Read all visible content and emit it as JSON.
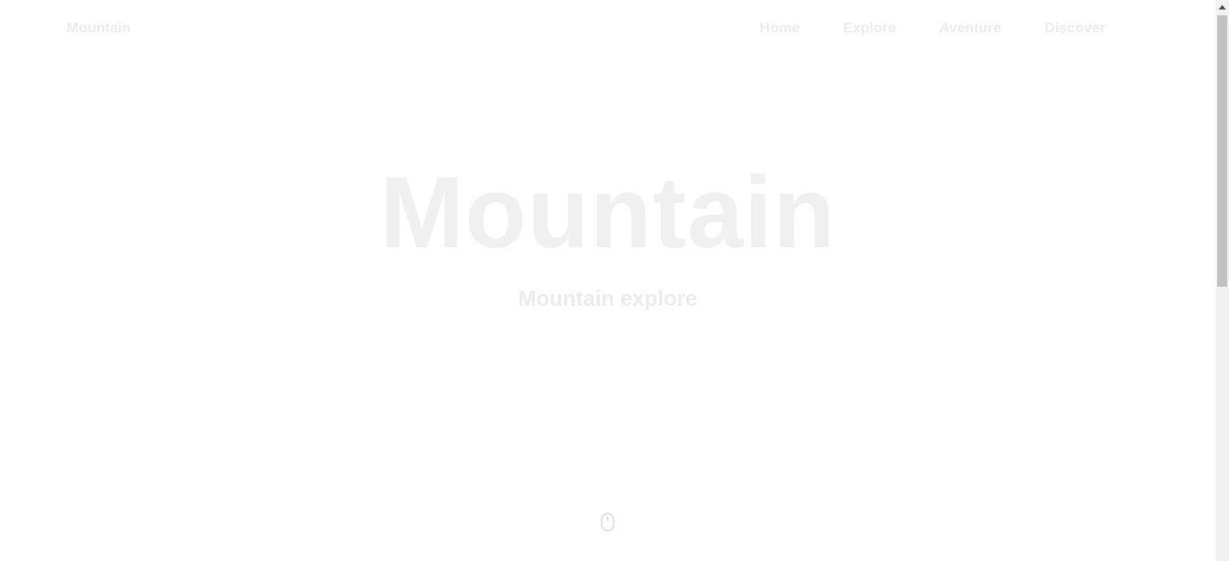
{
  "nav": {
    "brand": "Mountain",
    "links": [
      {
        "label": "Home"
      },
      {
        "label": "Explore"
      },
      {
        "label": "Aventure"
      },
      {
        "label": "Discover"
      }
    ]
  },
  "hero": {
    "title": "Mountain",
    "subtitle": "Mountain explore"
  },
  "scroll_hint": {
    "icon": "mouse-icon"
  },
  "colors": {
    "background": "#ffffff",
    "text_faint": "#ececec",
    "title_faint": "#f0f0f0",
    "scrollbar_track": "#f1f1f1",
    "scrollbar_thumb": "#c1c1c1"
  },
  "scrollbar": {
    "position": 0.0,
    "visible_fraction": 0.5
  }
}
